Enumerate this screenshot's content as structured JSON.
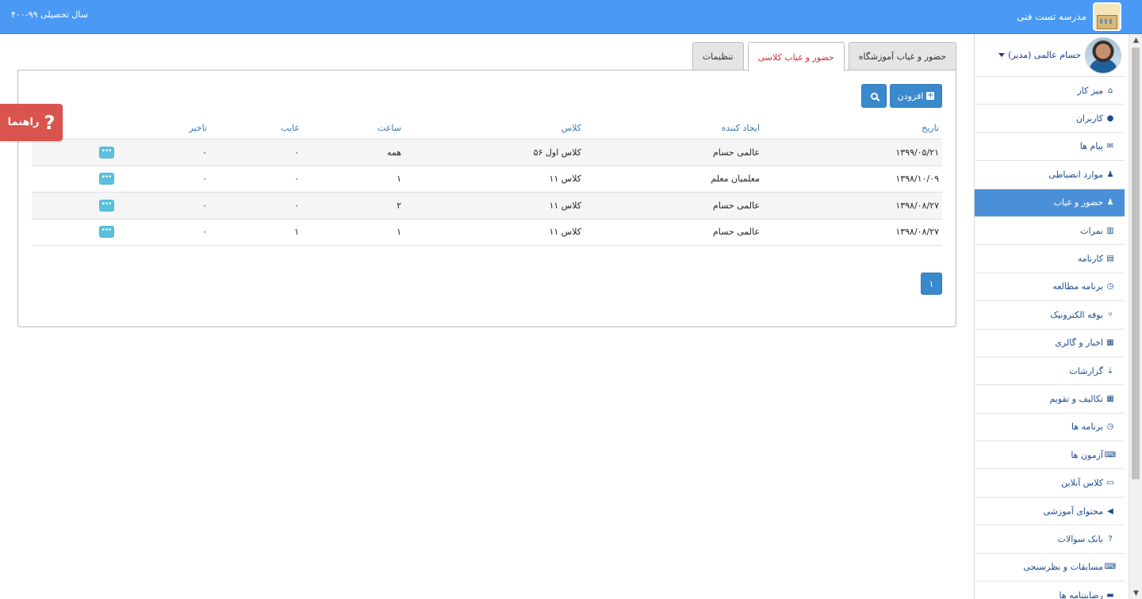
{
  "header": {
    "school_name": "مدرسه تست فنی",
    "academic_year": "سال تحصیلی ۹۹-۴۰۰"
  },
  "profile": {
    "name": "حسام عالمی (مدیر)"
  },
  "sidebar": {
    "items": [
      {
        "label": "میز کار",
        "icon": "home-icon",
        "glyph": "⌂"
      },
      {
        "label": "کاربران",
        "icon": "user-icon",
        "glyph": "●"
      },
      {
        "label": "پیام ها",
        "icon": "envelope-icon",
        "glyph": "✉"
      },
      {
        "label": "موارد انضباطی",
        "icon": "users-icon",
        "glyph": "♟"
      },
      {
        "label": "حضور و غیاب",
        "icon": "users-icon",
        "glyph": "♟"
      },
      {
        "label": "نمرات",
        "icon": "bar-chart-icon",
        "glyph": "▥"
      },
      {
        "label": "کارنامه",
        "icon": "list-alt-icon",
        "glyph": "▤"
      },
      {
        "label": "برنامه مطالعه",
        "icon": "clock-icon",
        "glyph": "◷"
      },
      {
        "label": "بوفه الکترونیک",
        "icon": "cutlery-icon",
        "glyph": "⑂"
      },
      {
        "label": "اخبار و گالری",
        "icon": "film-icon",
        "glyph": "▦"
      },
      {
        "label": "گزارشات",
        "icon": "sort-icon",
        "glyph": "⇣"
      },
      {
        "label": "تکالیف و تقویم",
        "icon": "calendar-icon",
        "glyph": "▦"
      },
      {
        "label": "برنامه ها",
        "icon": "clock-icon",
        "glyph": "◷"
      },
      {
        "label": "آزمون ها",
        "icon": "keyboard-icon",
        "glyph": "⌨"
      },
      {
        "label": "کلاس آنلاین",
        "icon": "desktop-icon",
        "glyph": "▭"
      },
      {
        "label": "محتوای آموزشی",
        "icon": "bullhorn-icon",
        "glyph": "◀"
      },
      {
        "label": "بانک سوالات",
        "icon": "question-circle-icon",
        "glyph": "?"
      },
      {
        "label": "مسابقات و نظرسنجی",
        "icon": "keyboard-icon",
        "glyph": "⌨"
      },
      {
        "label": "رضایتنامه ها",
        "icon": "briefcase-icon",
        "glyph": "▬"
      }
    ],
    "active_index": 4
  },
  "tabs": [
    {
      "label": "حضور و غیاب آموزشگاه"
    },
    {
      "label": "حضور و غیاب کلاسی"
    },
    {
      "label": "تنظیمات"
    }
  ],
  "toolbar": {
    "add_label": "افزودن"
  },
  "table": {
    "headers": {
      "date": "تاریخ",
      "creator": "ایجاد کننده",
      "class": "کلاس",
      "hour": "ساعت",
      "absent": "غایب",
      "late": "تاخیر"
    },
    "rows": [
      {
        "date": "۱۳۹۹/۰۵/۲۱",
        "creator": "عالمی حسام",
        "class": "کلاس اول ۵۶",
        "hour": "همه",
        "absent": "۰",
        "late": "۰"
      },
      {
        "date": "۱۳۹۸/۱۰/۰۹",
        "creator": "معلمیان معلم",
        "class": "کلاس ۱۱",
        "hour": "۱",
        "absent": "۰",
        "late": "۰"
      },
      {
        "date": "۱۳۹۸/۰۸/۲۷",
        "creator": "عالمی حسام",
        "class": "کلاس ۱۱",
        "hour": "۲",
        "absent": "۰",
        "late": "۰"
      },
      {
        "date": "۱۳۹۸/۰۸/۲۷",
        "creator": "عالمی حسام",
        "class": "کلاس ۱۱",
        "hour": "۱",
        "absent": "۱",
        "late": "۰"
      }
    ],
    "more_glyph": "•••"
  },
  "pagination": {
    "current_page": "۱"
  },
  "help": {
    "label": "راهنما",
    "glyph": "?"
  }
}
